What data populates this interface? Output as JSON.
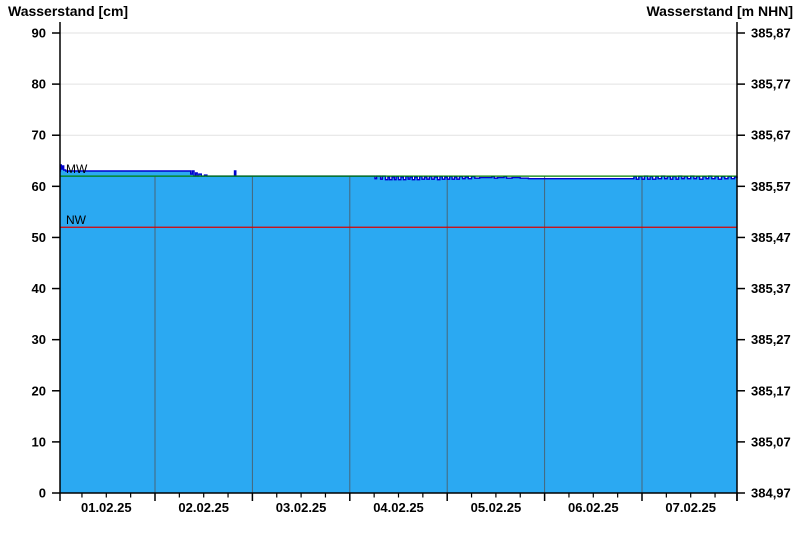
{
  "titles": {
    "left": "Wasserstand [cm]",
    "right": "Wasserstand [m NHN]"
  },
  "colors": {
    "background": "#FFFFFF",
    "area_fill": "#2BA9F2",
    "data_line": "#0000CD",
    "mw_line": "#008000",
    "nw_line": "#DC0000",
    "h_grid": "#E2E2E2",
    "day_grid": "#4D5A63",
    "axis": "#000000",
    "text": "#000000"
  },
  "chart_data": {
    "type": "area",
    "title": "Wasserstand",
    "xlabel": "",
    "ylabel_left": "Wasserstand [cm]",
    "ylabel_right": "Wasserstand [m NHN]",
    "ylim_cm": [
      0,
      90
    ],
    "x_range_hours": [
      0,
      168
    ],
    "x_major_tick_hours": 24,
    "x_minor_tick_hours": 6,
    "grid": true,
    "legend": false,
    "x_axis": {
      "day_labels": [
        "01.02.25",
        "02.02.25",
        "03.02.25",
        "04.02.25",
        "05.02.25",
        "06.02.25",
        "07.02.25"
      ]
    },
    "y_axis_left": {
      "tick_values": [
        0,
        10,
        20,
        30,
        40,
        50,
        60,
        70,
        80,
        90
      ],
      "tick_labels": [
        "0",
        "10",
        "20",
        "30",
        "40",
        "50",
        "60",
        "70",
        "80",
        "90"
      ]
    },
    "y_axis_right": {
      "tick_values": [
        0,
        10,
        20,
        30,
        40,
        50,
        60,
        70,
        80,
        90
      ],
      "tick_labels": [
        "384,97",
        "385,07",
        "385,17",
        "385,27",
        "385,37",
        "385,47",
        "385,57",
        "385,67",
        "385,77",
        "385,87"
      ]
    },
    "reference_lines": [
      {
        "label": "MW",
        "value_cm": 62,
        "color": "#008000"
      },
      {
        "label": "NW",
        "value_cm": 52,
        "color": "#DC0000"
      }
    ],
    "series": [
      {
        "name": "Wasserstand",
        "color": "#0000CD",
        "fill": "#2BA9F2",
        "points_hours_cm": [
          [
            0.6,
            63.0
          ],
          [
            0.7,
            64.2
          ],
          [
            0.9,
            63.4
          ],
          [
            1.2,
            64.0
          ],
          [
            1.5,
            63.2
          ],
          [
            2.0,
            63.0
          ],
          [
            6,
            63
          ],
          [
            12,
            63
          ],
          [
            18,
            63
          ],
          [
            24,
            63
          ],
          [
            30,
            63
          ],
          [
            32.4,
            63
          ],
          [
            32.8,
            62.4
          ],
          [
            33.2,
            63.0
          ],
          [
            33.6,
            62.0
          ],
          [
            34.0,
            62.6
          ],
          [
            34.4,
            62.0
          ],
          [
            34.8,
            62.4
          ],
          [
            35.4,
            62.0
          ],
          [
            36.2,
            62.2
          ],
          [
            36.8,
            62.0
          ],
          [
            40,
            62
          ],
          [
            43.4,
            62
          ],
          [
            43.6,
            63.0
          ],
          [
            43.9,
            62
          ],
          [
            48,
            62
          ],
          [
            56,
            62
          ],
          [
            64,
            62
          ],
          [
            72,
            62
          ],
          [
            77.8,
            62
          ],
          [
            78.2,
            61.5
          ],
          [
            78.6,
            62.0
          ],
          [
            79.6,
            61.4
          ],
          [
            80.0,
            62.0
          ],
          [
            80.8,
            61.3
          ],
          [
            81.4,
            61.8
          ],
          [
            81.8,
            61.3
          ],
          [
            82.4,
            61.8
          ],
          [
            83.0,
            61.3
          ],
          [
            83.4,
            61.9
          ],
          [
            84.0,
            61.3
          ],
          [
            84.6,
            61.8
          ],
          [
            85.2,
            61.3
          ],
          [
            85.8,
            61.9
          ],
          [
            86.4,
            61.4
          ],
          [
            86.8,
            61.8
          ],
          [
            87.4,
            61.3
          ],
          [
            88.0,
            61.8
          ],
          [
            88.6,
            61.3
          ],
          [
            89.2,
            61.9
          ],
          [
            89.8,
            61.4
          ],
          [
            90.4,
            61.8
          ],
          [
            91.0,
            61.4
          ],
          [
            91.6,
            61.9
          ],
          [
            92.2,
            61.4
          ],
          [
            92.8,
            61.8
          ],
          [
            93.6,
            61.3
          ],
          [
            94.2,
            61.9
          ],
          [
            94.8,
            61.4
          ],
          [
            95.4,
            61.8
          ],
          [
            96.0,
            61.4
          ],
          [
            96.6,
            61.9
          ],
          [
            97.2,
            61.4
          ],
          [
            97.8,
            61.8
          ],
          [
            98.4,
            61.4
          ],
          [
            99.0,
            61.9
          ],
          [
            99.8,
            61.5
          ],
          [
            100.4,
            61.8
          ],
          [
            101.2,
            61.5
          ],
          [
            102.0,
            61.9
          ],
          [
            102.8,
            61.6
          ],
          [
            104,
            61.7
          ],
          [
            106.5,
            61.7
          ],
          [
            107.0,
            61.9
          ],
          [
            107.6,
            61.6
          ],
          [
            108.4,
            61.7
          ],
          [
            110.0,
            61.9
          ],
          [
            110.6,
            61.6
          ],
          [
            112,
            61.7
          ],
          [
            114,
            61.6
          ],
          [
            116,
            61.5
          ],
          [
            125,
            61.5
          ],
          [
            135,
            61.5
          ],
          [
            141.4,
            61.5
          ],
          [
            142.0,
            61.9
          ],
          [
            142.6,
            61.4
          ],
          [
            143.2,
            61.9
          ],
          [
            144.0,
            61.4
          ],
          [
            144.6,
            62.0
          ],
          [
            145.4,
            61.4
          ],
          [
            146.0,
            61.9
          ],
          [
            146.6,
            61.4
          ],
          [
            147.4,
            61.9
          ],
          [
            148.0,
            61.5
          ],
          [
            148.8,
            62.0
          ],
          [
            149.6,
            61.5
          ],
          [
            150.2,
            61.9
          ],
          [
            151.0,
            61.4
          ],
          [
            151.6,
            61.9
          ],
          [
            152.4,
            61.4
          ],
          [
            153.0,
            62.0
          ],
          [
            153.8,
            61.5
          ],
          [
            154.4,
            61.9
          ],
          [
            155.2,
            61.5
          ],
          [
            156.0,
            62.0
          ],
          [
            156.8,
            61.5
          ],
          [
            157.4,
            61.9
          ],
          [
            158.2,
            61.4
          ],
          [
            159.0,
            61.9
          ],
          [
            159.8,
            61.5
          ],
          [
            160.4,
            62.0
          ],
          [
            161.2,
            61.5
          ],
          [
            162.0,
            61.9
          ],
          [
            162.8,
            61.4
          ],
          [
            163.6,
            61.9
          ],
          [
            164.4,
            61.5
          ],
          [
            165.2,
            61.9
          ],
          [
            166.0,
            61.5
          ],
          [
            166.8,
            61.8
          ],
          [
            167.4,
            61.6
          ]
        ]
      }
    ]
  }
}
